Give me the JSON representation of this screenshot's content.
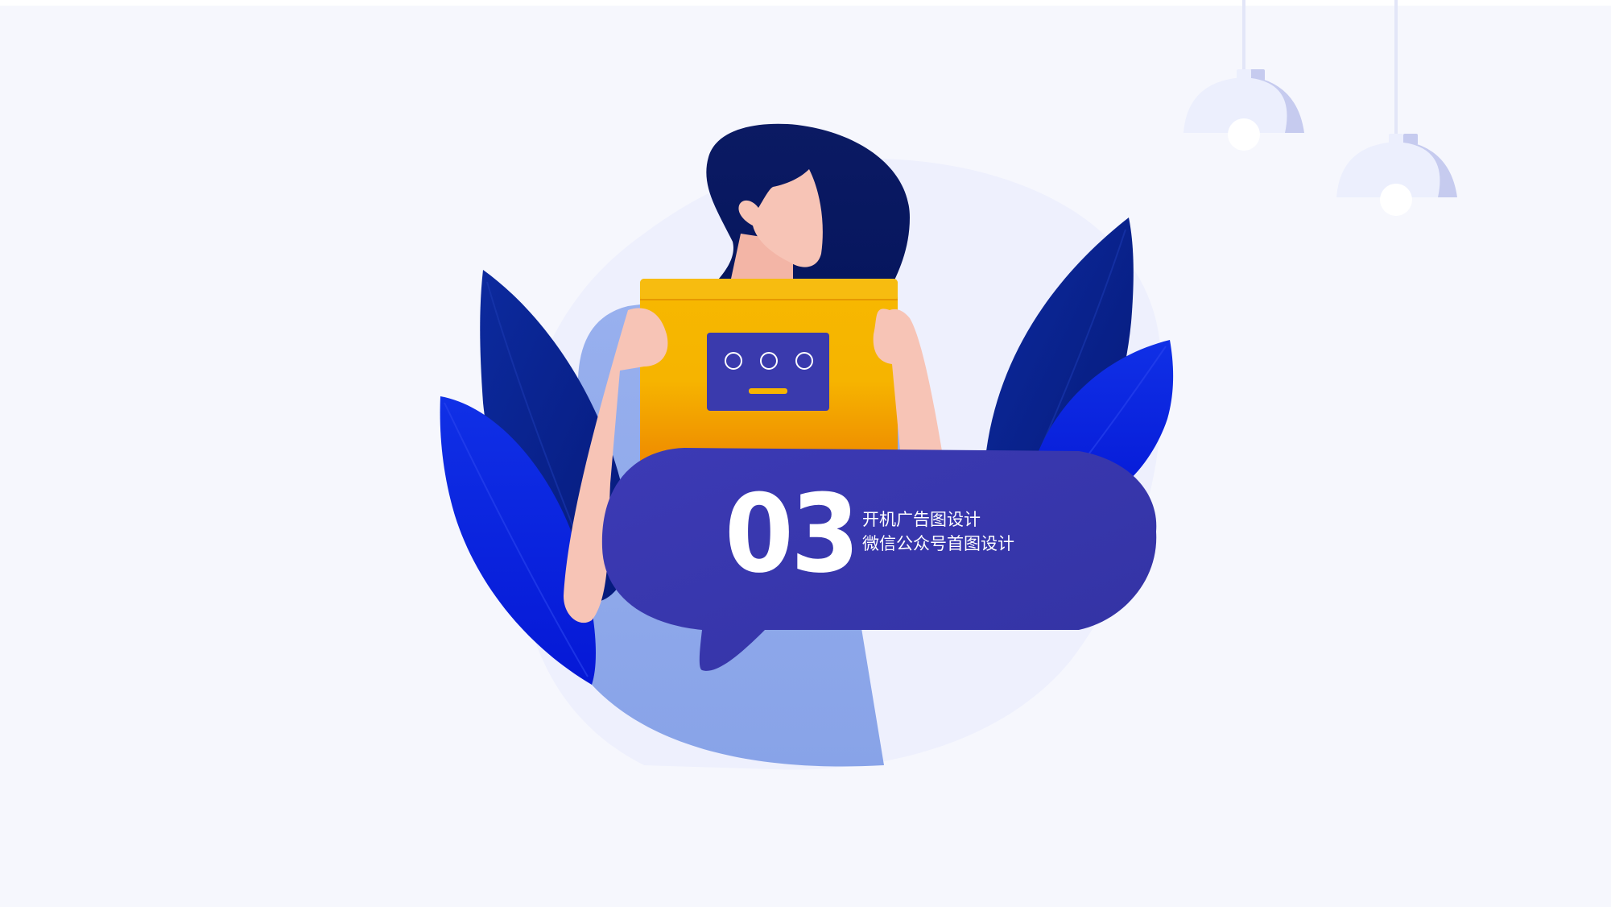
{
  "slide": {
    "number": "03",
    "lines": [
      "开机广告图设计",
      "微信公众号首图设计"
    ]
  },
  "colors": {
    "background": "#f6f7fd",
    "bubble": "#3a3aad",
    "box": "#f7b500",
    "hair": "#0e1b6b",
    "leaf_dark": "#0a1f8f",
    "leaf_bright": "#0a22e0",
    "shirt": "#8ca7ea",
    "skin": "#f7c4b6",
    "lamp": "#eceffd"
  },
  "icons": [
    "pendant-lamp-icon",
    "leaf-icon",
    "speech-bubble-icon",
    "robot-face-icon"
  ]
}
